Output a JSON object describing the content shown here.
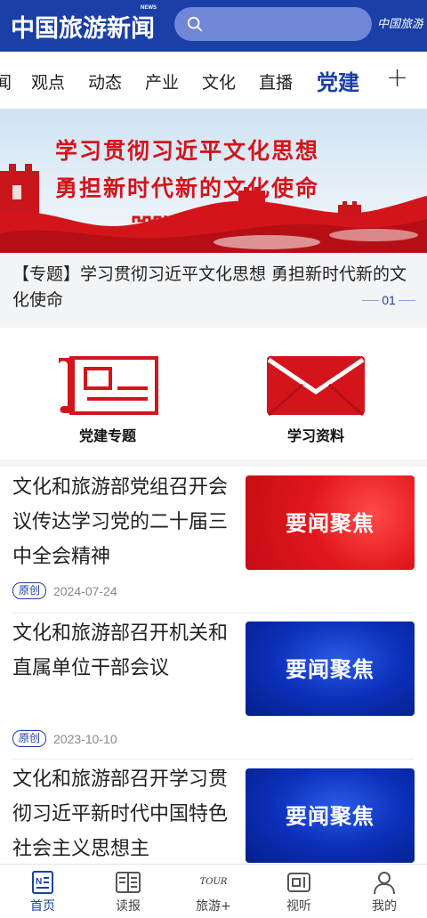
{
  "header": {
    "logo": "中国旅游新闻",
    "logo_news": "NEWS",
    "search_placeholder": "",
    "brand_right": "中国旅游报"
  },
  "tabs": [
    {
      "label": "闻"
    },
    {
      "label": "观点"
    },
    {
      "label": "动态"
    },
    {
      "label": "产业"
    },
    {
      "label": "文化"
    },
    {
      "label": "直播"
    },
    {
      "label": "党建",
      "active": true
    }
  ],
  "tab_add": "+",
  "banner": {
    "line1": "学习贯彻习近平文化思想",
    "line2": "勇担新时代新的文化使命",
    "caption": "【专题】学习贯彻习近平文化思想 勇担新时代新的文化使命",
    "page": "01"
  },
  "shortcuts": [
    {
      "label": "党建专题",
      "icon": "scroll-document-icon"
    },
    {
      "label": "学习资料",
      "icon": "envelope-icon"
    }
  ],
  "news": [
    {
      "title": "文化和旅游部党组召开会议传达学习党的二十届三中全会精神",
      "thumb_text": "要闻聚焦",
      "badge": "原创",
      "date": "2024-07-24",
      "thumb_color": "red"
    },
    {
      "title": "文化和旅游部召开机关和直属单位干部会议",
      "thumb_text": "要闻聚焦",
      "badge": "原创",
      "date": "2023-10-10",
      "thumb_color": "blue"
    },
    {
      "title": "文化和旅游部召开学习贯彻习近平新时代中国特色社会主义思想主",
      "thumb_text": "要闻聚焦",
      "thumb_color": "blue"
    }
  ],
  "bottom_nav": [
    {
      "label": "首页",
      "icon": "home-news-icon",
      "active": true
    },
    {
      "label": "读报",
      "icon": "newspaper-icon"
    },
    {
      "label": "旅游+",
      "icon": "tour-logo-icon",
      "badge": "TOUR"
    },
    {
      "label": "视听",
      "icon": "video-icon"
    },
    {
      "label": "我的",
      "icon": "user-icon"
    }
  ],
  "colors": {
    "brand_blue": "#1a3fa6",
    "banner_red": "#d4141b",
    "thumb_red": "#e1161d",
    "thumb_blue": "#0b2fb8"
  }
}
